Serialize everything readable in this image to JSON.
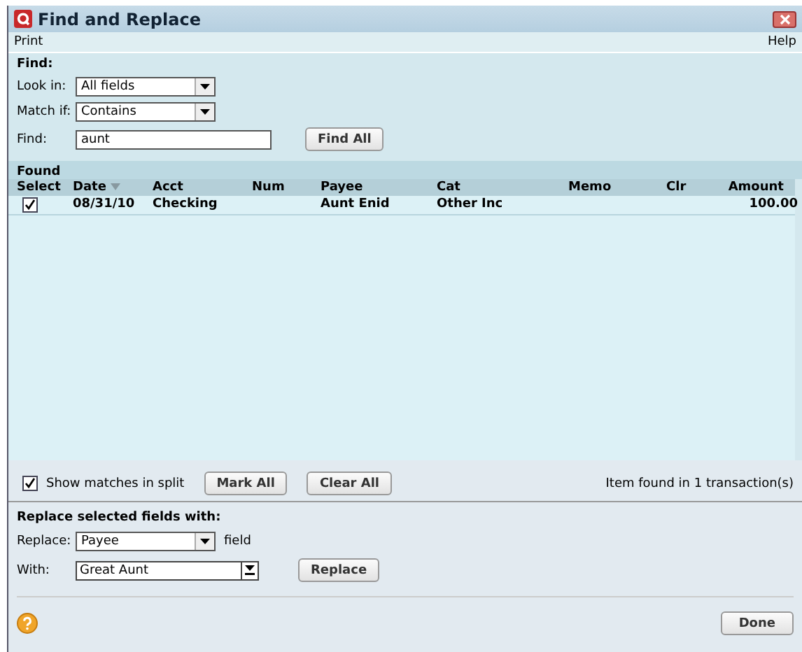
{
  "window": {
    "title": "Find and Replace"
  },
  "menu": [
    {
      "label": "Print"
    },
    {
      "label": "Help"
    }
  ],
  "find": {
    "heading": "Find:",
    "look_in": {
      "label": "Look in:",
      "value": "All fields"
    },
    "match_if": {
      "label": "Match if:",
      "value": "Contains"
    },
    "find_field": {
      "label": "Find:",
      "value": "aunt"
    },
    "find_all_button": "Find All"
  },
  "found": {
    "heading": "Found",
    "columns": [
      {
        "label": "Select",
        "sorted": false
      },
      {
        "label": "Date",
        "sorted": true
      },
      {
        "label": "Acct",
        "sorted": false
      },
      {
        "label": "Num",
        "sorted": false
      },
      {
        "label": "Payee",
        "sorted": false
      },
      {
        "label": "Cat",
        "sorted": false
      },
      {
        "label": "Memo",
        "sorted": false
      },
      {
        "label": "Clr",
        "sorted": false
      },
      {
        "label": "Amount",
        "sorted": false
      }
    ],
    "rows": [
      {
        "checked": true,
        "date": "08/31/10",
        "acct": "Checking",
        "payee": "Aunt Enid",
        "cat": "Other Inc",
        "amount": "100.00"
      }
    ]
  },
  "show_matches": {
    "label": "Show matches in split",
    "checked": true
  },
  "mark_all_button": "Mark All",
  "clear_all_button": "Clear All",
  "result_text": "Item found in 1 transaction(s)",
  "replace": {
    "heading": "Replace selected fields with:",
    "replace_field": {
      "label": "Replace:",
      "value": "Payee",
      "suffix": "field"
    },
    "with_field": {
      "label": "With:",
      "value": "Great Aunt"
    },
    "replace_button": "Replace"
  },
  "done_button": "Done"
}
